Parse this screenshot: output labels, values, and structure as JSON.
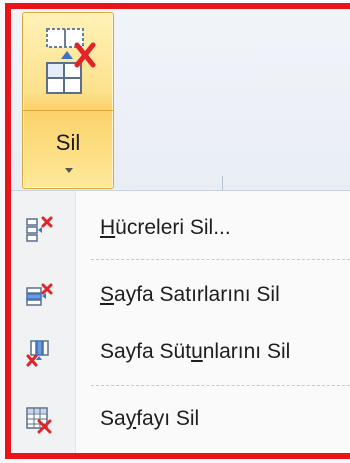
{
  "ribbon": {
    "delete_button": {
      "label": "Sil",
      "icon": "delete-cells-icon"
    }
  },
  "menu": {
    "items": [
      {
        "label_pre": "",
        "accel": "H",
        "label_post": "ücreleri Sil...",
        "icon": "delete-cells-icon"
      },
      {
        "label_pre": "",
        "accel": "S",
        "label_post": "ayfa Satırlarını Sil",
        "icon": "delete-rows-icon"
      },
      {
        "label_pre": "Sayfa Süt",
        "accel": "u",
        "label_post": "nlarını Sil",
        "icon": "delete-columns-icon"
      },
      {
        "label_pre": "Sa",
        "accel": "y",
        "label_post": "fayı Sil",
        "icon": "delete-sheet-icon"
      }
    ]
  },
  "colors": {
    "highlight_border": "#e8141a",
    "button_active": "#fde18c",
    "delete_x": "#e0242a"
  }
}
